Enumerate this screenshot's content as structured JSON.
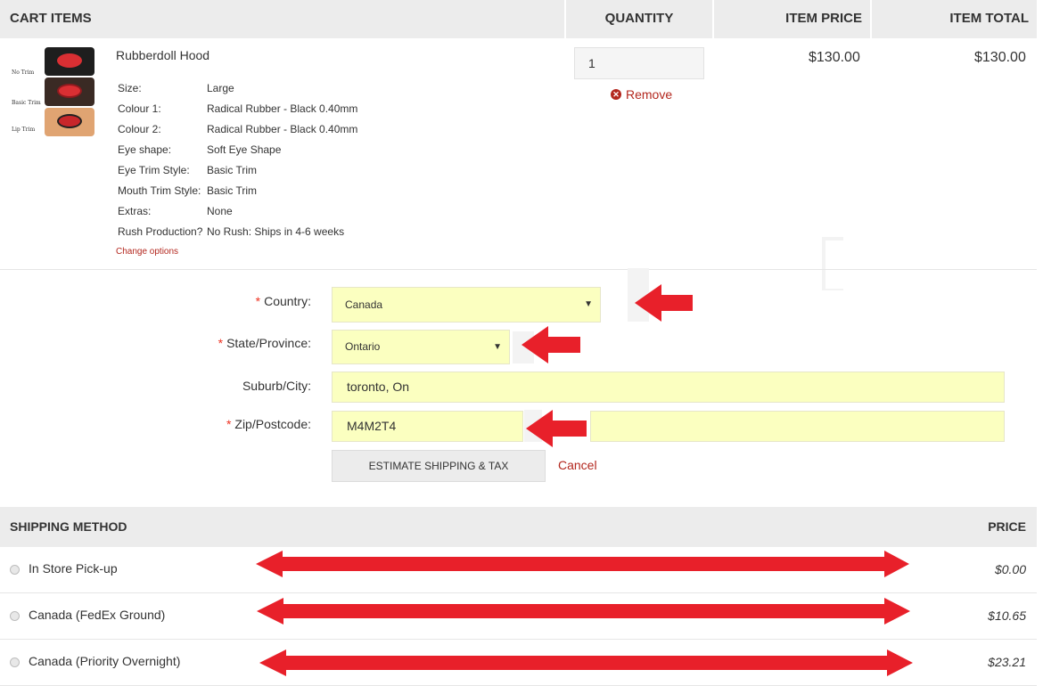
{
  "cart_header": {
    "items": "CART ITEMS",
    "quantity": "QUANTITY",
    "item_price": "ITEM PRICE",
    "item_total": "ITEM TOTAL"
  },
  "item": {
    "name": "Rubberdoll Hood",
    "thumb_labels": [
      "No Trim",
      "Basic Trim",
      "Lip Trim"
    ],
    "options": [
      {
        "label": "Size:",
        "value": "Large"
      },
      {
        "label": "Colour 1:",
        "value": "Radical Rubber - Black 0.40mm"
      },
      {
        "label": "Colour 2:",
        "value": "Radical Rubber - Black 0.40mm"
      },
      {
        "label": "Eye shape:",
        "value": "Soft Eye Shape"
      },
      {
        "label": "Eye Trim Style:",
        "value": "Basic Trim"
      },
      {
        "label": "Mouth Trim Style:",
        "value": "Basic Trim"
      },
      {
        "label": "Extras:",
        "value": "None"
      },
      {
        "label": "Rush Production?",
        "value": "No Rush: Ships in 4-6 weeks"
      }
    ],
    "change_options": "Change options",
    "quantity": "1",
    "remove": "Remove",
    "price": "$130.00",
    "total": "$130.00"
  },
  "estimate": {
    "required_mark": "*",
    "country_label": "Country:",
    "country_value": "Canada",
    "state_label": "State/Province:",
    "state_value": "Ontario",
    "city_label": "Suburb/City:",
    "city_value": "toronto, On",
    "zip_label": "Zip/Postcode:",
    "zip_value": "M4M2T4",
    "button": "ESTIMATE SHIPPING & TAX",
    "cancel": "Cancel"
  },
  "shipping": {
    "header": "SHIPPING METHOD",
    "price_header": "PRICE",
    "methods": [
      {
        "name": "In Store Pick-up",
        "price": "$0.00"
      },
      {
        "name": "Canada (FedEx Ground)",
        "price": "$10.65"
      },
      {
        "name": "Canada (Priority Overnight)",
        "price": "$23.21"
      }
    ]
  },
  "colors": {
    "accent_red": "#b3271e",
    "annotation_red": "#e8202a",
    "field_highlight": "#fbffc0",
    "header_gray": "#ececec"
  }
}
